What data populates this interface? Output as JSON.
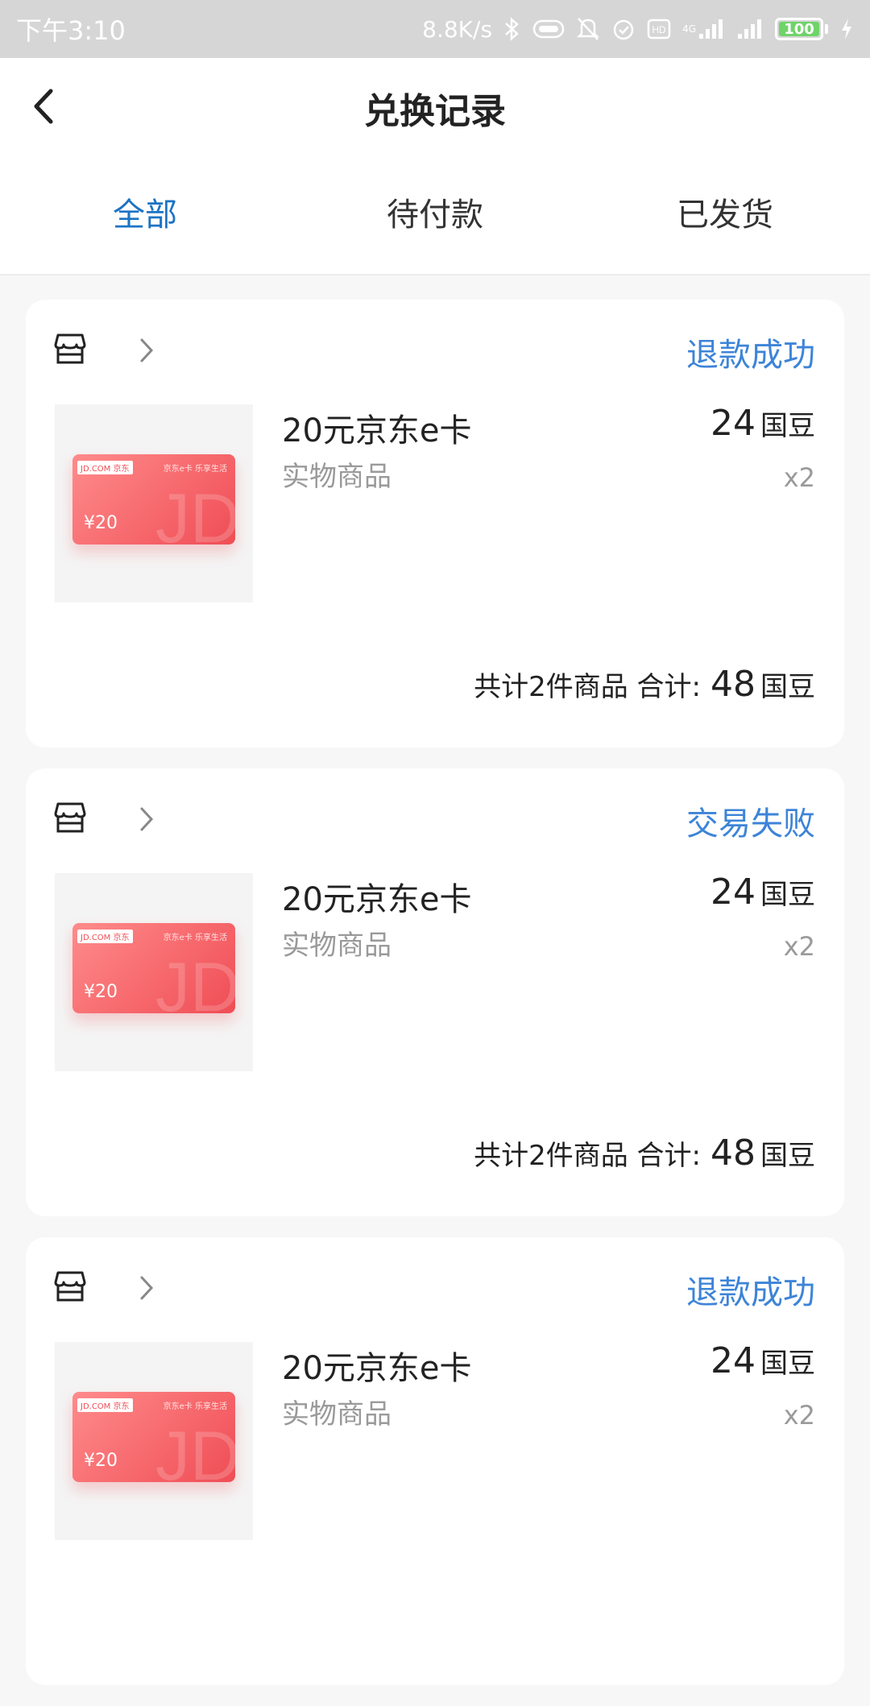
{
  "status_bar": {
    "time": "下午3:10",
    "net_speed": "8.8K/s",
    "network_label": "4G",
    "battery": "100",
    "icons": [
      "bluetooth-icon",
      "toggle-icon",
      "mute-icon",
      "alarm-icon",
      "hd-icon",
      "signal-icon",
      "signal-icon",
      "battery-icon",
      "charging-icon"
    ]
  },
  "header": {
    "title": "兑换记录",
    "back_icon": "chevron-left-icon"
  },
  "tabs": [
    {
      "label": "全部",
      "active": true
    },
    {
      "label": "待付款",
      "active": false
    },
    {
      "label": "已发货",
      "active": false
    }
  ],
  "orders": [
    {
      "status": "退款成功",
      "product_name": "20元京东e卡",
      "product_type": "实物商品",
      "price": "24",
      "price_unit": "国豆",
      "quantity": "x2",
      "summary_label": "共计2件商品 合计:",
      "total": "48",
      "total_unit": "国豆",
      "card_image": {
        "logo": "JD.COM 京东",
        "slogan": "京东e卡 乐享生活",
        "price": "¥20",
        "watermark": "JD"
      }
    },
    {
      "status": "交易失败",
      "product_name": "20元京东e卡",
      "product_type": "实物商品",
      "price": "24",
      "price_unit": "国豆",
      "quantity": "x2",
      "summary_label": "共计2件商品 合计:",
      "total": "48",
      "total_unit": "国豆",
      "card_image": {
        "logo": "JD.COM 京东",
        "slogan": "京东e卡 乐享生活",
        "price": "¥20",
        "watermark": "JD"
      }
    },
    {
      "status": "退款成功",
      "product_name": "20元京东e卡",
      "product_type": "实物商品",
      "price": "24",
      "price_unit": "国豆",
      "quantity": "x2",
      "summary_label": "",
      "total": "",
      "total_unit": "",
      "card_image": {
        "logo": "JD.COM 京东",
        "slogan": "京东e卡 乐享生活",
        "price": "¥20",
        "watermark": "JD"
      }
    }
  ],
  "colors": {
    "accent_tab": "#1c73c4",
    "status_text": "#3d84d8",
    "background": "#f7f7f7",
    "card_gradient_start": "#ff8b8b",
    "card_gradient_end": "#ef4d55"
  }
}
